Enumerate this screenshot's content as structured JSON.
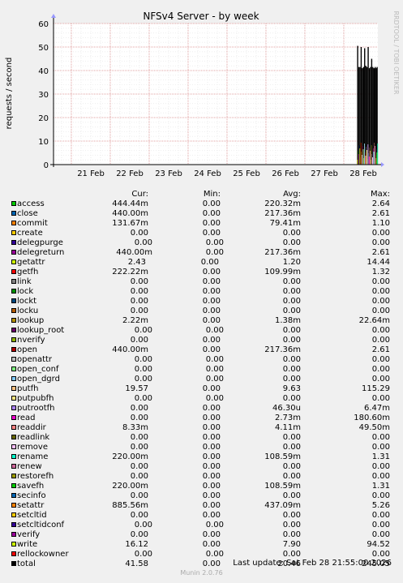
{
  "title": "NFSv4 Server - by week",
  "ylabel": "requests / second",
  "side_label": "RRDTOOL / TOBI OETIKER",
  "footer": {
    "last_update": "Last update: Sat Feb 28 21:55:00 2026",
    "version": "Munin 2.0.76"
  },
  "legend_header": {
    "cur": "Cur:",
    "min": "Min:",
    "avg": "Avg:",
    "max": "Max:"
  },
  "chart_data": {
    "type": "bar",
    "title": "NFSv4 Server - by week",
    "ylabel": "requests / second",
    "ylim": [
      0,
      60
    ],
    "yticks": [
      "0",
      "10",
      "20",
      "30",
      "40",
      "50",
      "60"
    ],
    "xticks": [
      "21 Feb",
      "22 Feb",
      "23 Feb",
      "24 Feb",
      "25 Feb",
      "26 Feb",
      "27 Feb",
      "28 Feb"
    ],
    "grid": true,
    "spikes": [
      {
        "x": 0.0,
        "y": 50.5
      },
      {
        "x": 0.06,
        "y": 41.5
      },
      {
        "x": 0.12,
        "y": 41.5
      },
      {
        "x": 0.18,
        "y": 50.0
      },
      {
        "x": 0.24,
        "y": 41.0
      },
      {
        "x": 0.3,
        "y": 41.5
      },
      {
        "x": 0.36,
        "y": 49.5
      },
      {
        "x": 0.42,
        "y": 42.0
      },
      {
        "x": 0.48,
        "y": 41.5
      },
      {
        "x": 0.54,
        "y": 50.0
      },
      {
        "x": 0.6,
        "y": 41.0
      },
      {
        "x": 0.66,
        "y": 41.5
      },
      {
        "x": 0.72,
        "y": 45.0
      },
      {
        "x": 0.78,
        "y": 41.5
      },
      {
        "x": 0.84,
        "y": 41.0
      },
      {
        "x": 0.9,
        "y": 41.5
      },
      {
        "x": 0.96,
        "y": 41.0
      },
      {
        "x": 1.0,
        "y": 41.5
      }
    ],
    "series": [
      {
        "name": "access",
        "color": "#00cc00",
        "cur": "444.44m",
        "min": "0.00",
        "avg": "220.32m",
        "max": "2.64"
      },
      {
        "name": "close",
        "color": "#0066b3",
        "cur": "440.00m",
        "min": "0.00",
        "avg": "217.36m",
        "max": "2.61"
      },
      {
        "name": "commit",
        "color": "#ff8000",
        "cur": "131.67m",
        "min": "0.00",
        "avg": "79.41m",
        "max": "1.10"
      },
      {
        "name": "create",
        "color": "#ffcc00",
        "cur": "0.00",
        "min": "0.00",
        "avg": "0.00",
        "max": "0.00"
      },
      {
        "name": "delegpurge",
        "color": "#330099",
        "cur": "0.00",
        "min": "0.00",
        "avg": "0.00",
        "max": "0.00",
        "align": "a"
      },
      {
        "name": "delegreturn",
        "color": "#990099",
        "cur": "440.00m",
        "min": "0.00",
        "avg": "217.36m",
        "max": "2.61",
        "align": "a"
      },
      {
        "name": "getattr",
        "color": "#ccff00",
        "cur": "2.43",
        "min": "0.00",
        "avg": "1.20",
        "max": "14.44",
        "align": "b"
      },
      {
        "name": "getfh",
        "color": "#ff0000",
        "cur": "222.22m",
        "min": "0.00",
        "avg": "109.99m",
        "max": "1.32"
      },
      {
        "name": "link",
        "color": "#808080",
        "cur": "0.00",
        "min": "0.00",
        "avg": "0.00",
        "max": "0.00"
      },
      {
        "name": "lock",
        "color": "#008f00",
        "cur": "0.00",
        "min": "0.00",
        "avg": "0.00",
        "max": "0.00"
      },
      {
        "name": "lockt",
        "color": "#00487d",
        "cur": "0.00",
        "min": "0.00",
        "avg": "0.00",
        "max": "0.00"
      },
      {
        "name": "locku",
        "color": "#b35a00",
        "cur": "0.00",
        "min": "0.00",
        "avg": "0.00",
        "max": "0.00"
      },
      {
        "name": "lookup",
        "color": "#b38f00",
        "cur": "2.22m",
        "min": "0.00",
        "avg": "1.38m",
        "max": "22.64m"
      },
      {
        "name": "lookup_root",
        "color": "#6b006b",
        "cur": "0.00",
        "min": "0.00",
        "avg": "0.00",
        "max": "0.00",
        "align": "a"
      },
      {
        "name": "nverify",
        "color": "#8fb300",
        "cur": "0.00",
        "min": "0.00",
        "avg": "0.00",
        "max": "0.00"
      },
      {
        "name": "open",
        "color": "#b30000",
        "cur": "440.00m",
        "min": "0.00",
        "avg": "217.36m",
        "max": "2.61"
      },
      {
        "name": "openattr",
        "color": "#bebebe",
        "cur": "0.00",
        "min": "0.00",
        "avg": "0.00",
        "max": "0.00",
        "align": "a"
      },
      {
        "name": "open_conf",
        "color": "#80ff80",
        "cur": "0.00",
        "min": "0.00",
        "avg": "0.00",
        "max": "0.00",
        "align": "a"
      },
      {
        "name": "open_dgrd",
        "color": "#80c9ff",
        "cur": "0.00",
        "min": "0.00",
        "avg": "0.00",
        "max": "0.00",
        "align": "a"
      },
      {
        "name": "putfh",
        "color": "#ffc080",
        "cur": "19.57",
        "min": "0.00",
        "avg": "9.63",
        "max": "115.29"
      },
      {
        "name": "putpubfh",
        "color": "#ffe680",
        "cur": "0.00",
        "min": "0.00",
        "avg": "0.00",
        "max": "0.00",
        "align": "a"
      },
      {
        "name": "putrootfh",
        "color": "#aa80ff",
        "cur": "0.00",
        "min": "0.00",
        "avg": "46.30u",
        "max": "6.47m"
      },
      {
        "name": "read",
        "color": "#ee00cc",
        "cur": "0.00",
        "min": "0.00",
        "avg": "2.73m",
        "max": "180.60m"
      },
      {
        "name": "readdir",
        "color": "#ff8080",
        "cur": "8.33m",
        "min": "0.00",
        "avg": "4.11m",
        "max": "49.50m"
      },
      {
        "name": "readlink",
        "color": "#666600",
        "cur": "0.00",
        "min": "0.00",
        "avg": "0.00",
        "max": "0.00"
      },
      {
        "name": "remove",
        "color": "#ffbfff",
        "cur": "0.00",
        "min": "0.00",
        "avg": "0.00",
        "max": "0.00"
      },
      {
        "name": "rename",
        "color": "#00ffcc",
        "cur": "220.00m",
        "min": "0.00",
        "avg": "108.59m",
        "max": "1.31"
      },
      {
        "name": "renew",
        "color": "#cc6699",
        "cur": "0.00",
        "min": "0.00",
        "avg": "0.00",
        "max": "0.00"
      },
      {
        "name": "restorefh",
        "color": "#999900",
        "cur": "0.00",
        "min": "0.00",
        "avg": "0.00",
        "max": "0.00"
      },
      {
        "name": "savefh",
        "color": "#00cc00",
        "cur": "220.00m",
        "min": "0.00",
        "avg": "108.59m",
        "max": "1.31"
      },
      {
        "name": "secinfo",
        "color": "#0066b3",
        "cur": "0.00",
        "min": "0.00",
        "avg": "0.00",
        "max": "0.00"
      },
      {
        "name": "setattr",
        "color": "#ff8000",
        "cur": "885.56m",
        "min": "0.00",
        "avg": "437.09m",
        "max": "5.26"
      },
      {
        "name": "setcltid",
        "color": "#ffcc00",
        "cur": "0.00",
        "min": "0.00",
        "avg": "0.00",
        "max": "0.00"
      },
      {
        "name": "setcltidconf",
        "color": "#330099",
        "cur": "0.00",
        "min": "0.00",
        "avg": "0.00",
        "max": "0.00",
        "align": "a"
      },
      {
        "name": "verify",
        "color": "#990099",
        "cur": "0.00",
        "min": "0.00",
        "avg": "0.00",
        "max": "0.00"
      },
      {
        "name": "write",
        "color": "#ccff00",
        "cur": "16.12",
        "min": "0.00",
        "avg": "7.90",
        "max": "94.52"
      },
      {
        "name": "rellockowner",
        "color": "#ff0000",
        "cur": "0.00",
        "min": "0.00",
        "avg": "0.00",
        "max": "0.00",
        "align": "a"
      },
      {
        "name": "total",
        "color": "#000000",
        "cur": "41.58",
        "min": "0.00",
        "avg": "20.46",
        "max": "245.05"
      }
    ]
  }
}
